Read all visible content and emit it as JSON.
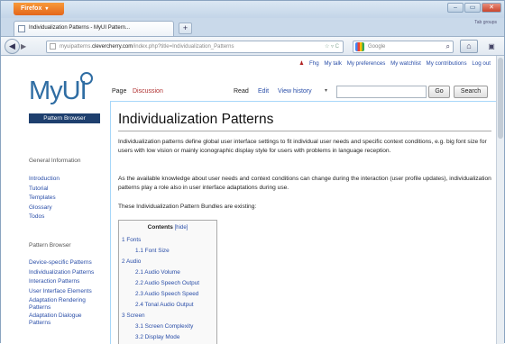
{
  "browser": {
    "menu_button": "Firefox",
    "tab_title": "Individualization Patterns - MyUI Pattern...",
    "new_tab": "+",
    "tab_list": "Tab groups",
    "url_prefix": "myuipatterns.",
    "url_domain": "clevercherry.com",
    "url_path": "/index.php?title=Individualization_Patterns",
    "url_right": "☆ ▿ C",
    "search_placeholder": "Google",
    "window_min": "–",
    "window_max": "▭",
    "window_close": "✕"
  },
  "personal_tools": {
    "user": "Fhg",
    "items": [
      "My talk",
      "My preferences",
      "My watchlist",
      "My contributions",
      "Log out"
    ]
  },
  "logo": {
    "text": "MyUI",
    "banner": "Pattern Browser"
  },
  "sidebar": {
    "general_heading": "General Information",
    "general_items": [
      "Introduction",
      "Tutorial",
      "Templates",
      "Glossary",
      "Todos"
    ],
    "pattern_heading": "Pattern Browser",
    "pattern_items": [
      "Device-specific Patterns",
      "Individualization Patterns",
      "Interaction Patterns",
      "User Interface Elements",
      "Adaptation Rendering Patterns",
      "Adaptation Dialogue Patterns"
    ]
  },
  "content_tabs": {
    "page": "Page",
    "discussion": "Discussion",
    "read": "Read",
    "edit": "Edit",
    "view_history": "View history",
    "more": "▾",
    "go": "Go",
    "search": "Search"
  },
  "article": {
    "title": "Individualization Patterns",
    "para1": "Individualization patterns define global user interface settings to fit individual user needs and specific context conditions, e.g. big font size for users with low vision or mainly iconographic display style for users with problems in language reception.",
    "para2": "As the available knowledge about user needs and context conditions can change during the interaction (user profile updates), individualization patterns play a role also in user interface adaptations during use.",
    "para3": "These Individualization Pattern Bundles are existing:"
  },
  "toc": {
    "title": "Contents",
    "hide": "[hide]",
    "items": [
      {
        "label": "1 Fonts",
        "level": 1
      },
      {
        "label": "1.1 Font Size",
        "level": 2
      },
      {
        "label": "2 Audio",
        "level": 1
      },
      {
        "label": "2.1 Audio Volume",
        "level": 2
      },
      {
        "label": "2.2 Audio Speech Output",
        "level": 2
      },
      {
        "label": "2.3 Audio Speech Speed",
        "level": 2
      },
      {
        "label": "2.4 Tonal Audio Output",
        "level": 2
      },
      {
        "label": "3 Screen",
        "level": 1
      },
      {
        "label": "3.1 Screen Complexity",
        "level": 2
      },
      {
        "label": "3.2 Display Mode",
        "level": 2
      }
    ]
  }
}
